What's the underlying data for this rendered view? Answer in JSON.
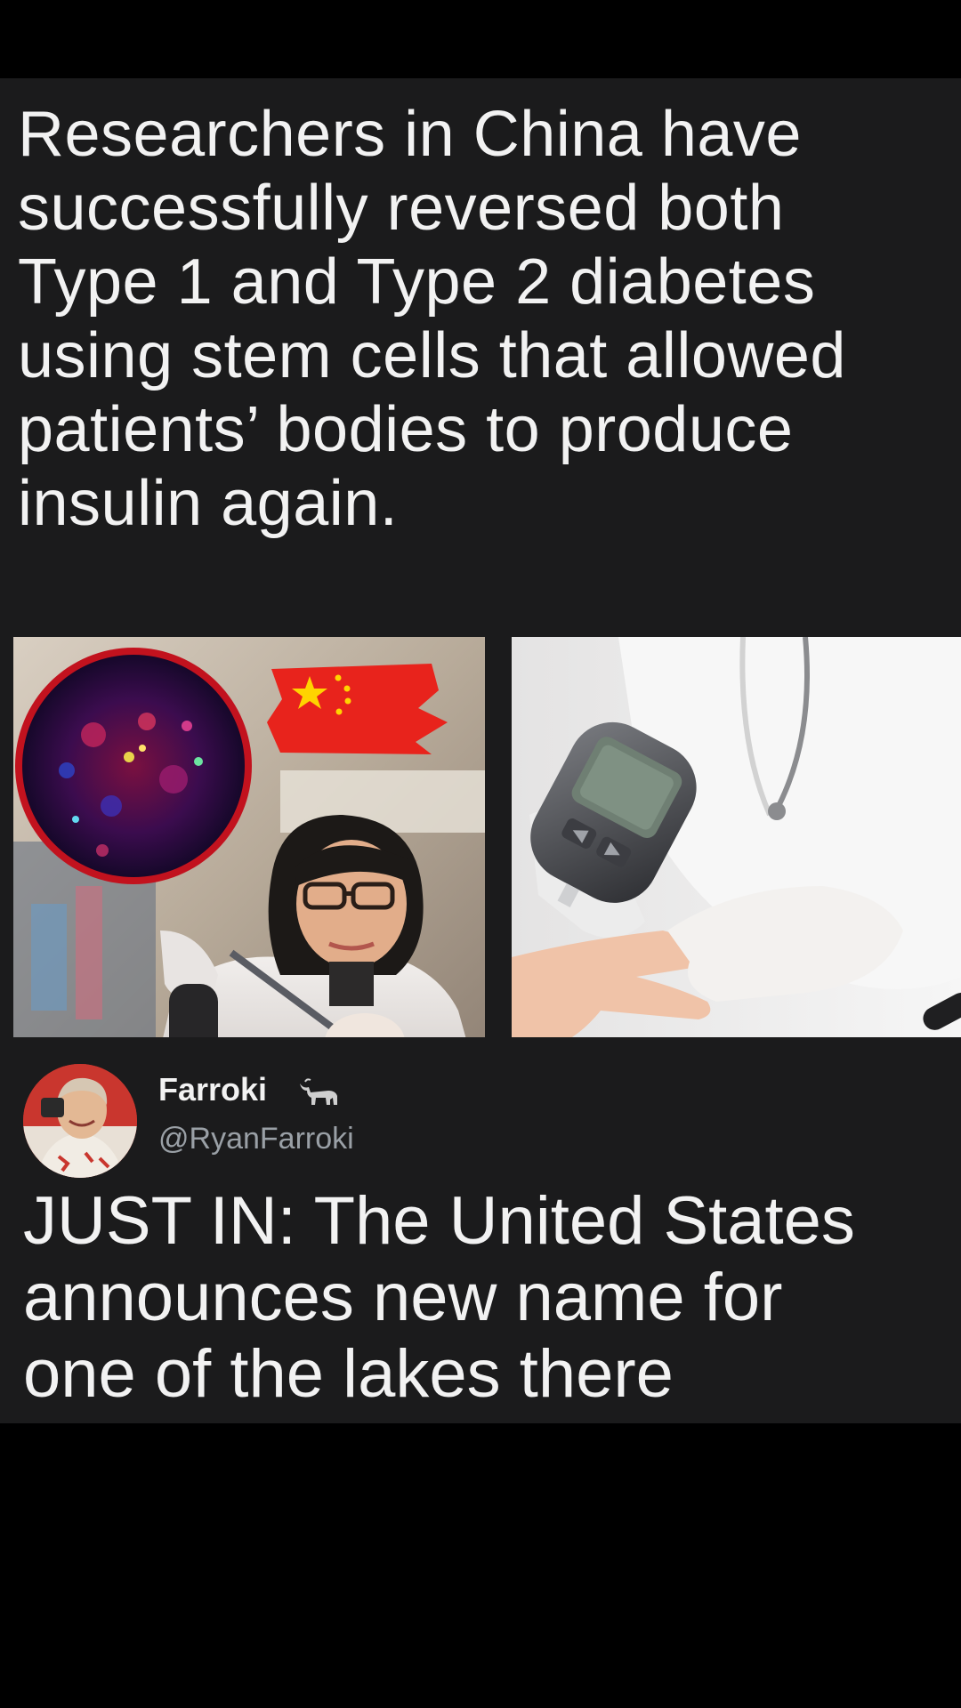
{
  "post": {
    "headline": "Researchers in China have\nsuccessfully reversed both\nType 1 and Type 2 diabetes\nusing stem cells that allowed\npatients’ bodies to produce\ninsulin again.",
    "images": [
      {
        "icon": "scientist-with-china-flag-photo"
      },
      {
        "icon": "glucose-meter-finger-test-photo"
      }
    ]
  },
  "tweet": {
    "display_name": "Farroki",
    "name_icon": "bull-icon",
    "handle": "@RyanFarroki",
    "text": "JUST IN: The United States\nannounces new name for\none of the lakes there"
  },
  "colors": {
    "background": "#000000",
    "card": "#1b1b1c",
    "text": "#f2f2f2",
    "handle": "#9aa0a6",
    "flag_red": "#e8231c",
    "flag_star": "#ffd400"
  }
}
